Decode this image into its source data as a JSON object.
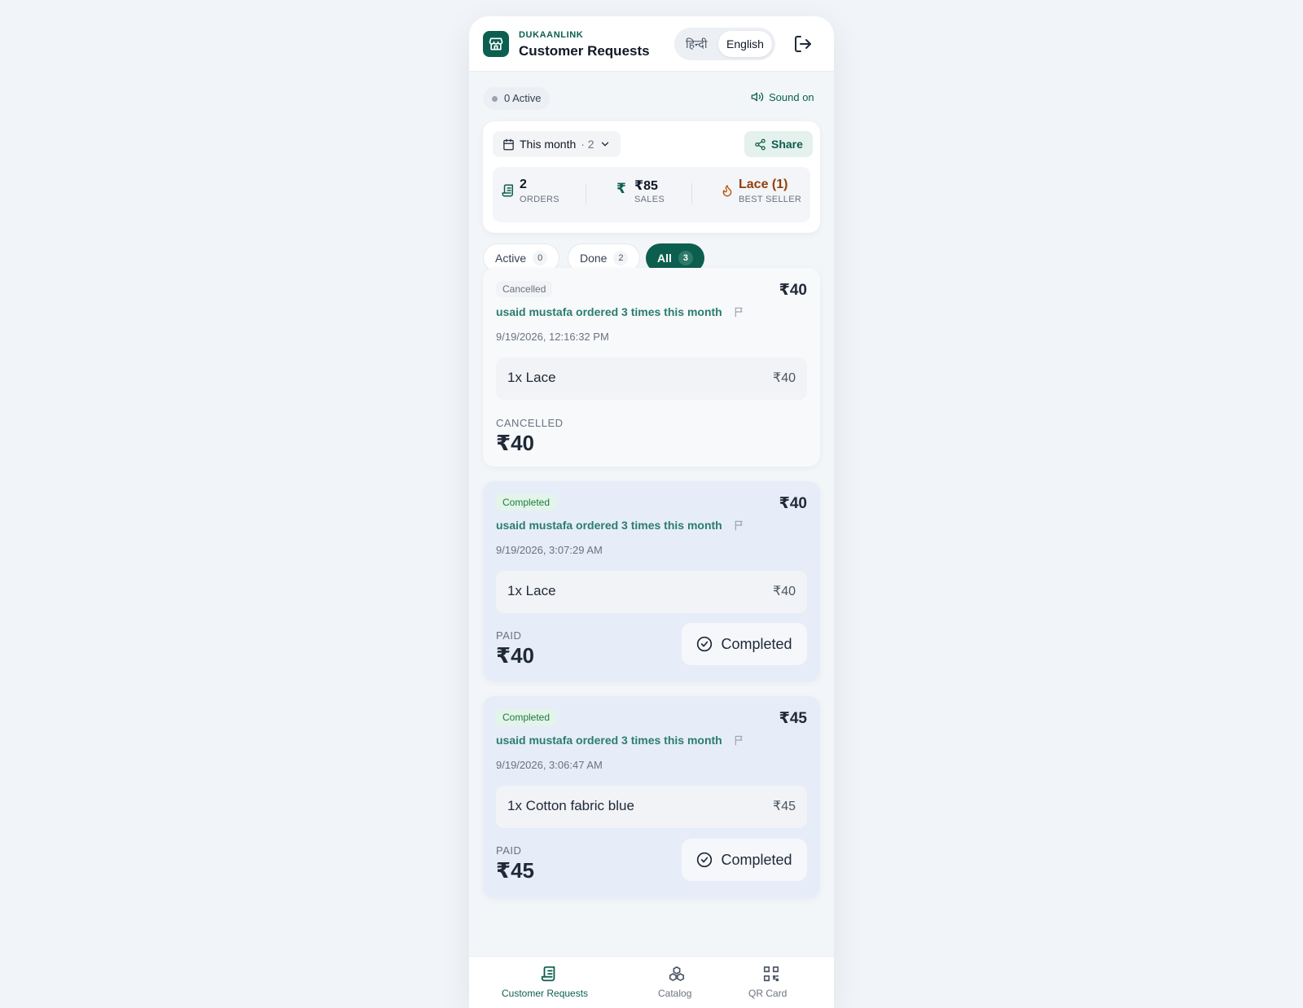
{
  "header": {
    "brand": "DUKAANLINK",
    "title": "Customer Requests",
    "lang_hindi": "हिन्दी",
    "lang_english": "English"
  },
  "status": {
    "active_text": "0 Active",
    "sound_text": "Sound on"
  },
  "summary": {
    "period_label": "This month",
    "period_count": "· 2",
    "share_label": "Share",
    "orders_value": "2",
    "orders_label": "ORDERS",
    "sales_value": "₹85",
    "sales_label": "SALES",
    "best_value": "Lace (1)",
    "best_label": "BEST SELLER"
  },
  "tabs": [
    {
      "label": "Active",
      "count": "0"
    },
    {
      "label": "Done",
      "count": "2"
    },
    {
      "label": "All",
      "count": "3"
    }
  ],
  "orders": [
    {
      "status": "Cancelled",
      "price": "₹40",
      "repeat": "usaid mustafa ordered 3 times this month",
      "time": "9/19/2026, 12:16:32 PM",
      "item_name": "1x Lace",
      "item_amount": "₹40",
      "total_label": "CANCELLED",
      "total_value": "₹40"
    },
    {
      "status": "Completed",
      "price": "₹40",
      "repeat": "usaid mustafa ordered 3 times this month",
      "time": "9/19/2026, 3:07:29 AM",
      "item_name": "1x Lace",
      "item_amount": "₹40",
      "total_label": "PAID",
      "total_value": "₹40",
      "action_label": "Completed"
    },
    {
      "status": "Completed",
      "price": "₹45",
      "repeat": "usaid mustafa ordered 3 times this month",
      "time": "9/19/2026, 3:06:47 AM",
      "item_name": "1x Cotton fabric blue",
      "item_amount": "₹45",
      "total_label": "PAID",
      "total_value": "₹45",
      "action_label": "Completed"
    }
  ],
  "nav": [
    {
      "label": "Customer Requests",
      "icon": "receipt-icon"
    },
    {
      "label": "Catalog",
      "icon": "boxes-icon"
    },
    {
      "label": "QR Card",
      "icon": "qr-code-icon"
    }
  ],
  "colors": {
    "accent": "#0c5f4f",
    "completed_card": "#e6edf8",
    "completed_badge": "#1e7a45"
  }
}
